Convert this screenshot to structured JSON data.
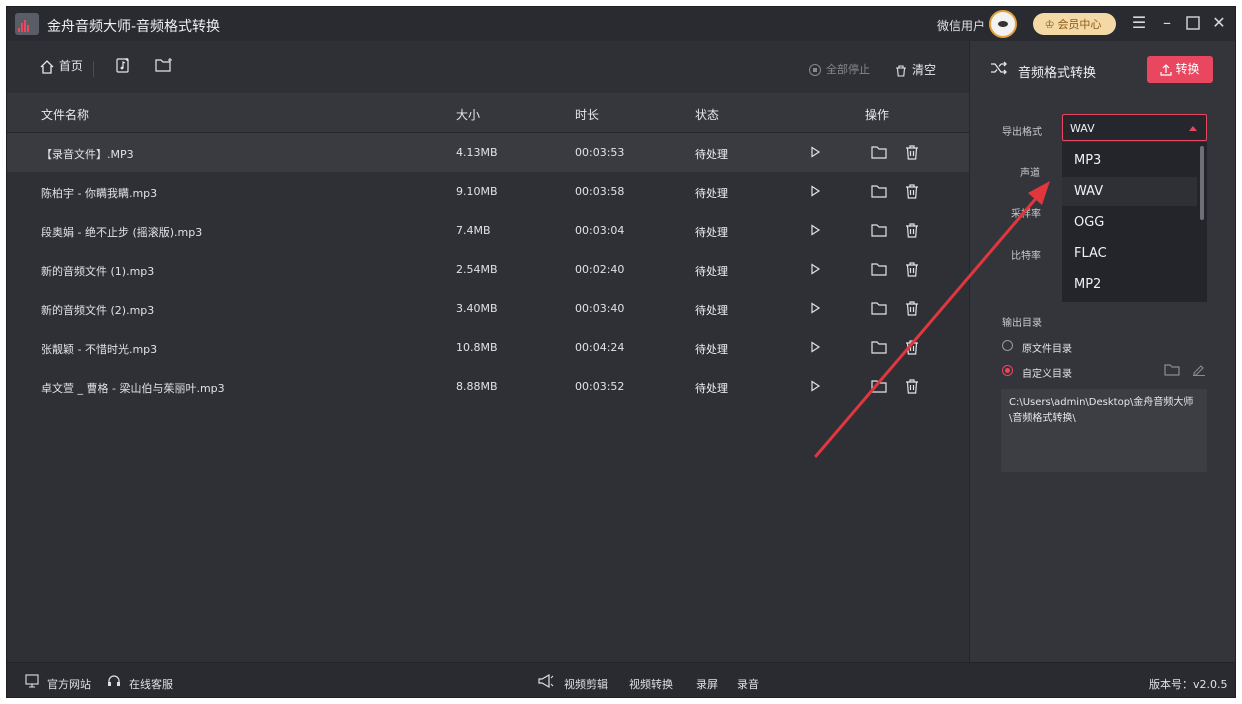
{
  "app": {
    "title": "金舟音频大师-音频格式转换",
    "user_name": "微信用户",
    "vip_label": "会员中心"
  },
  "toolbar": {
    "home_label": "首页",
    "stop_all_label": "全部停止",
    "clear_label": "清空"
  },
  "table": {
    "headers": {
      "name": "文件名称",
      "size": "大小",
      "duration": "时长",
      "status": "状态",
      "actions": "操作"
    },
    "rows": [
      {
        "name": "【录音文件】.MP3",
        "size": "4.13MB",
        "duration": "00:03:53",
        "status": "待处理"
      },
      {
        "name": "陈柏宇 - 你瞒我瞒.mp3",
        "size": "9.10MB",
        "duration": "00:03:58",
        "status": "待处理"
      },
      {
        "name": "段奥娟 - 绝不止步 (摇滚版).mp3",
        "size": "7.4MB",
        "duration": "00:03:04",
        "status": "待处理"
      },
      {
        "name": "新的音频文件 (1).mp3",
        "size": "2.54MB",
        "duration": "00:02:40",
        "status": "待处理"
      },
      {
        "name": "新的音频文件 (2).mp3",
        "size": "3.40MB",
        "duration": "00:03:40",
        "status": "待处理"
      },
      {
        "name": "张靓颖 - 不惜时光.mp3",
        "size": "10.8MB",
        "duration": "00:04:24",
        "status": "待处理"
      },
      {
        "name": "卓文萱 _ 曹格 - 梁山伯与茱丽叶.mp3",
        "size": "8.88MB",
        "duration": "00:03:52",
        "status": "待处理"
      }
    ]
  },
  "panel": {
    "title": "音频格式转换",
    "convert_label": "转换",
    "export_format_label": "导出格式",
    "export_format_value": "WAV",
    "channel_label": "声道",
    "sample_label": "采样率",
    "bitrate_label": "比特率",
    "format_options": [
      "MP3",
      "WAV",
      "OGG",
      "FLAC",
      "MP2"
    ],
    "output_dir_label": "输出目录",
    "radio_original": "原文件目录",
    "radio_custom": "自定义目录",
    "output_path": "C:\\Users\\admin\\Desktop\\金舟音频大师\\音频格式转换\\"
  },
  "statusbar": {
    "website": "官方网站",
    "support": "在线客服",
    "links": [
      "视频剪辑",
      "视频转换",
      "录屏",
      "录音"
    ],
    "version": "版本号：v2.0.5"
  },
  "colors": {
    "accent": "#e8475f",
    "background": "#2f3036",
    "annotation_arrow": "#e0373f"
  }
}
